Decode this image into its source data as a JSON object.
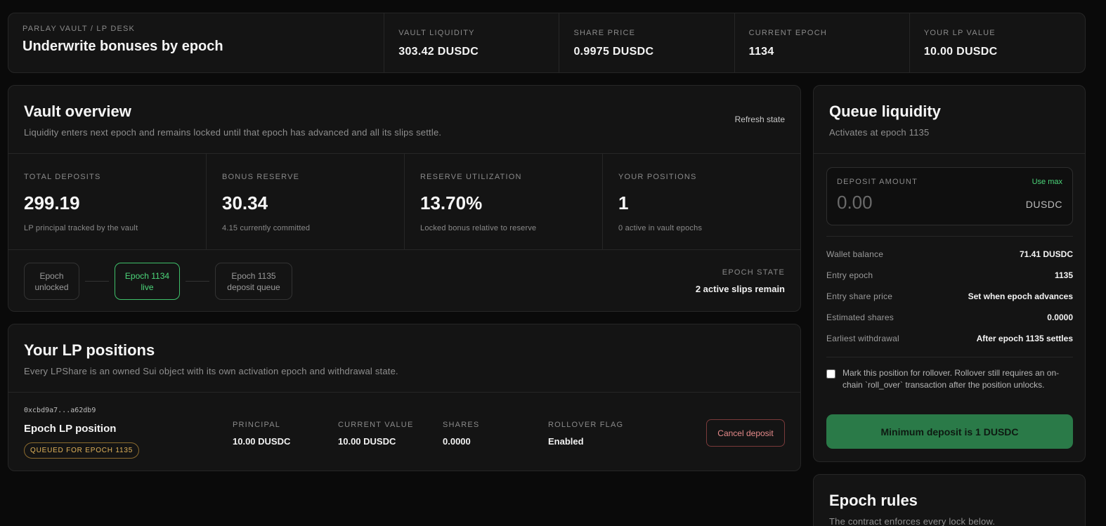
{
  "header": {
    "kicker": "PARLAY VAULT / LP DESK",
    "title": "Underwrite bonuses by epoch",
    "stats": [
      {
        "label": "VAULT LIQUIDITY",
        "value": "303.42 DUSDC"
      },
      {
        "label": "SHARE PRICE",
        "value": "0.9975 DUSDC"
      },
      {
        "label": "CURRENT EPOCH",
        "value": "1134"
      },
      {
        "label": "YOUR LP VALUE",
        "value": "10.00 DUSDC"
      }
    ]
  },
  "vault": {
    "title": "Vault overview",
    "subtitle": "Liquidity enters next epoch and remains locked until that epoch has advanced and all its slips settle.",
    "refresh_label": "Refresh state",
    "stats": [
      {
        "label": "TOTAL DEPOSITS",
        "value": "299.19",
        "note": "LP principal tracked by the vault"
      },
      {
        "label": "BONUS RESERVE",
        "value": "30.34",
        "note": "4.15 currently committed"
      },
      {
        "label": "RESERVE UTILIZATION",
        "value": "13.70%",
        "note": "Locked bonus relative to reserve"
      },
      {
        "label": "YOUR POSITIONS",
        "value": "1",
        "note": "0 active in vault epochs"
      }
    ],
    "epochs": [
      {
        "line1": "Epoch",
        "line2": "unlocked"
      },
      {
        "line1": "Epoch 1134",
        "line2": "live"
      },
      {
        "line1": "Epoch 1135",
        "line2": "deposit queue"
      }
    ],
    "epoch_state_label": "EPOCH STATE",
    "epoch_state_value": "2 active slips remain"
  },
  "lp": {
    "title": "Your LP positions",
    "subtitle": "Every LPShare is an owned Sui object with its own activation epoch and withdrawal state.",
    "position": {
      "id": "0xcbd9a7...a62db9",
      "name": "Epoch LP position",
      "badge": "QUEUED FOR EPOCH 1135",
      "columns": [
        {
          "label": "PRINCIPAL",
          "value": "10.00 DUSDC"
        },
        {
          "label": "CURRENT VALUE",
          "value": "10.00 DUSDC"
        },
        {
          "label": "SHARES",
          "value": "0.0000"
        },
        {
          "label": "ROLLOVER FLAG",
          "value": "Enabled"
        }
      ],
      "cancel_label": "Cancel deposit"
    }
  },
  "queue": {
    "title": "Queue liquidity",
    "subtitle": "Activates at epoch 1135",
    "deposit_label": "DEPOSIT AMOUNT",
    "use_max_label": "Use max",
    "deposit_placeholder": "0.00",
    "deposit_unit": "DUSDC",
    "details": [
      {
        "key": "Wallet balance",
        "value": "71.41 DUSDC"
      },
      {
        "key": "Entry epoch",
        "value": "1135"
      },
      {
        "key": "Entry share price",
        "value": "Set when epoch advances"
      },
      {
        "key": "Estimated shares",
        "value": "0.0000"
      },
      {
        "key": "Earliest withdrawal",
        "value": "After epoch 1135 settles"
      }
    ],
    "rollover_text": "Mark this position for rollover. Rollover still requires an on-chain `roll_over` transaction after the position unlocks.",
    "submit_label": "Minimum deposit is 1 DUSDC"
  },
  "rules": {
    "title": "Epoch rules",
    "subtitle": "The contract enforces every lock below."
  }
}
